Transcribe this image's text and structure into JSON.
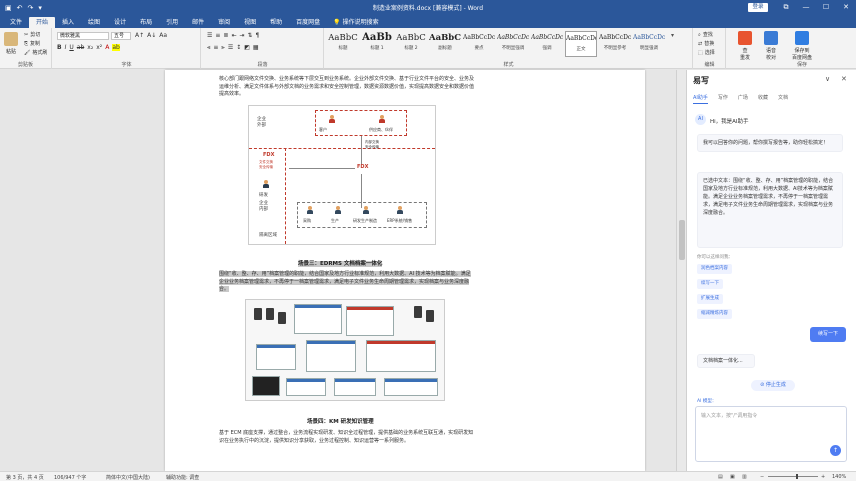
{
  "window": {
    "title": "制造业案例资料.docx [兼容模式] - Word",
    "login_label": "登录",
    "controls": [
      "⧉",
      "—",
      "☐",
      "✕"
    ]
  },
  "menu": {
    "tabs": [
      "文件",
      "开始",
      "插入",
      "绘图",
      "设计",
      "布局",
      "引用",
      "邮件",
      "审阅",
      "视图",
      "帮助",
      "百度网盘"
    ],
    "active": "开始",
    "tell_me": "操作说明搜索"
  },
  "ribbon": {
    "clipboard": {
      "paste": "粘贴",
      "cut": "剪切",
      "copy": "复制",
      "format_painter": "格式刷",
      "label": "剪贴板"
    },
    "font": {
      "name": "微软雅黑",
      "size": "五号",
      "label": "字体"
    },
    "paragraph": {
      "label": "段落"
    },
    "styles": {
      "label": "样式",
      "items": [
        {
          "preview": "AaBbC",
          "name": "标题"
        },
        {
          "preview": "AaBb",
          "name": "标题 1"
        },
        {
          "preview": "AaBbC",
          "name": "标题 2"
        },
        {
          "preview": "AaBbC",
          "name": "副标题"
        },
        {
          "preview": "AaBbCcDc",
          "name": "要点"
        },
        {
          "preview": "AaBbCcDc",
          "name": "不明显强调"
        },
        {
          "preview": "AaBbCcDc",
          "name": "强调"
        },
        {
          "preview": "AaBbCcDd",
          "name": "正文"
        },
        {
          "preview": "AaBbCcDc",
          "name": "不明显参考"
        },
        {
          "preview": "AaBbCcDc",
          "name": "明显强调"
        }
      ]
    },
    "editing": {
      "find": "查找",
      "replace": "替换",
      "select": "选择",
      "label": "编辑"
    },
    "tools": [
      {
        "name": "查\n重发",
        "label": ""
      },
      {
        "name": "语音\n校对",
        "label": ""
      },
      {
        "name": "保存到\n百度网盘",
        "label": "保存"
      }
    ]
  },
  "document": {
    "para1": "核心部门跟网络文件交换、业务系统等下层交互到业务系统。企业外部文件交换、基于行业文件平台的安全、业务及运维分析、满足文件体系与外部文档的业务需求和安全控制管理，数据资源数据价值，实现提高数据安全和数据价值提高效率。",
    "diagram": {
      "zone_outside": "企业\n外部",
      "zone_inside": "企业\n内部",
      "fdx_left": "FDX",
      "fdx_center": "FDX",
      "doc_exchange": "文件交换\n安全传输",
      "internal_exchange": "内部交换\n安全传输",
      "rd": "研发",
      "mgmt": "管理",
      "customer": "客户",
      "supplier": "供应商、伙伴",
      "depts": [
        "采购",
        "生产",
        "研发生产制造",
        "ERP系统/销售"
      ],
      "network": "隔离区域"
    },
    "caption1": "场景三：EDRMS 文档档案一体化",
    "para2": "围绕“收、整、存、用”档案管理的职能，结合国家及地方行业标准规范，利用大数据、AI 技术等为档案赋能。满足企业业务档案管理需求，不再停于一档案管理需求，满足电子文件业务生命周期管理需求，实现档案与业务深度融合。",
    "caption2": "场景四：KM 研发知识管理",
    "para3": "基于 ECM 底座支撑，通过整合，业务流程实现研发、知识全过程管理，提供基础的业务系统互联互通，实现研发知识在业务执行中的沉淀，提供知识分享获取，业务过程控制、知识运营等一系列服务。"
  },
  "statusbar": {
    "page": "第 3 页，共 4 页",
    "words": "106/947 个字",
    "language": "简体中文(中国大陆)",
    "accessibility": "辅助功能: 调查",
    "zoom": "140%"
  },
  "ai_panel": {
    "title": "易写",
    "controls": [
      "∨",
      "✕"
    ],
    "tabs": [
      "AI助手",
      "写作",
      "广场",
      "收藏",
      "文档"
    ],
    "avatar": "AI",
    "greeting": "Hi，我是AI助手",
    "intro": "我可以回答你的问题，帮你撰写报告等，助你轻松搞定！",
    "selected_text": "已选中文本：围绕“收、整、存、用”档案管理的职能，结合国家及地方行业标准规范，利用大数据、AI技术等为档案赋能。满足企业业务档案管理需求，不再停于一档案管理需求，满足电子文件业务生命周期管理需求，实现档案与业务深度融合。",
    "suggest_label": "你可以这样问我：",
    "suggestions": [
      "润色档案内容",
      "续写一下",
      "扩展生成",
      "缩减精炼内容"
    ],
    "user_message": "续写一下",
    "reply": "文档档案一体化...",
    "stop": "停止生成",
    "model_label": "AI 模型：",
    "input_placeholder": "输入文本，按\"/\"调用指令",
    "send_icon": "↑"
  }
}
